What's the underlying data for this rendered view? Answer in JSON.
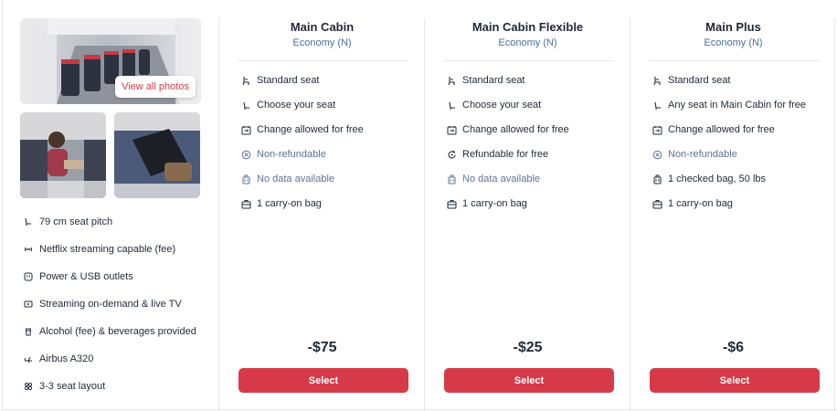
{
  "photos": {
    "view_all_label": "View all photos"
  },
  "amenities": [
    {
      "icon": "seat-pitch-icon",
      "label": "79 cm seat pitch"
    },
    {
      "icon": "wifi-icon",
      "label": "Netflix streaming capable (fee)"
    },
    {
      "icon": "power-outlet-icon",
      "label": "Power & USB outlets"
    },
    {
      "icon": "tv-icon",
      "label": "Streaming on-demand & live TV"
    },
    {
      "icon": "drink-icon",
      "label": "Alcohol (fee) & beverages provided"
    },
    {
      "icon": "plane-icon",
      "label": "Airbus A320"
    },
    {
      "icon": "seat-layout-icon",
      "label": "3-3 seat layout"
    }
  ],
  "fares": [
    {
      "title": "Main Cabin",
      "cabin_class": "Economy (N)",
      "features": [
        {
          "icon": "seat-icon",
          "label": "Standard seat",
          "muted": false
        },
        {
          "icon": "seat-select-icon",
          "label": "Choose your seat",
          "muted": false
        },
        {
          "icon": "change-icon",
          "label": "Change allowed for free",
          "muted": false
        },
        {
          "icon": "not-allowed-icon",
          "label": "Non-refundable",
          "muted": true
        },
        {
          "icon": "bag-icon",
          "label": "No data available",
          "muted": true
        },
        {
          "icon": "carry-on-icon",
          "label": "1 carry-on bag",
          "muted": false
        }
      ],
      "price": "-$75",
      "button_label": "Select"
    },
    {
      "title": "Main Cabin Flexible",
      "cabin_class": "Economy (N)",
      "features": [
        {
          "icon": "seat-icon",
          "label": "Standard seat",
          "muted": false
        },
        {
          "icon": "seat-select-icon",
          "label": "Choose your seat",
          "muted": false
        },
        {
          "icon": "change-icon",
          "label": "Change allowed for free",
          "muted": false
        },
        {
          "icon": "refund-icon",
          "label": "Refundable for free",
          "muted": false
        },
        {
          "icon": "bag-icon",
          "label": "No data available",
          "muted": true
        },
        {
          "icon": "carry-on-icon",
          "label": "1 carry-on bag",
          "muted": false
        }
      ],
      "price": "-$25",
      "button_label": "Select"
    },
    {
      "title": "Main Plus",
      "cabin_class": "Economy (N)",
      "features": [
        {
          "icon": "seat-icon",
          "label": "Standard seat",
          "muted": false
        },
        {
          "icon": "seat-select-icon",
          "label": "Any seat in Main Cabin for free",
          "muted": false
        },
        {
          "icon": "change-icon",
          "label": "Change allowed for free",
          "muted": false
        },
        {
          "icon": "not-allowed-icon",
          "label": "Non-refundable",
          "muted": true
        },
        {
          "icon": "bag-icon",
          "label": "1 checked bag, 50 lbs",
          "muted": false
        },
        {
          "icon": "carry-on-icon",
          "label": "1 carry-on bag",
          "muted": false
        }
      ],
      "price": "-$6",
      "button_label": "Select"
    }
  ],
  "colors": {
    "accent": "#d63a48",
    "link": "#4a6fa5",
    "muted": "#5d7396",
    "text": "#1f2937",
    "border": "#e5e7eb"
  }
}
